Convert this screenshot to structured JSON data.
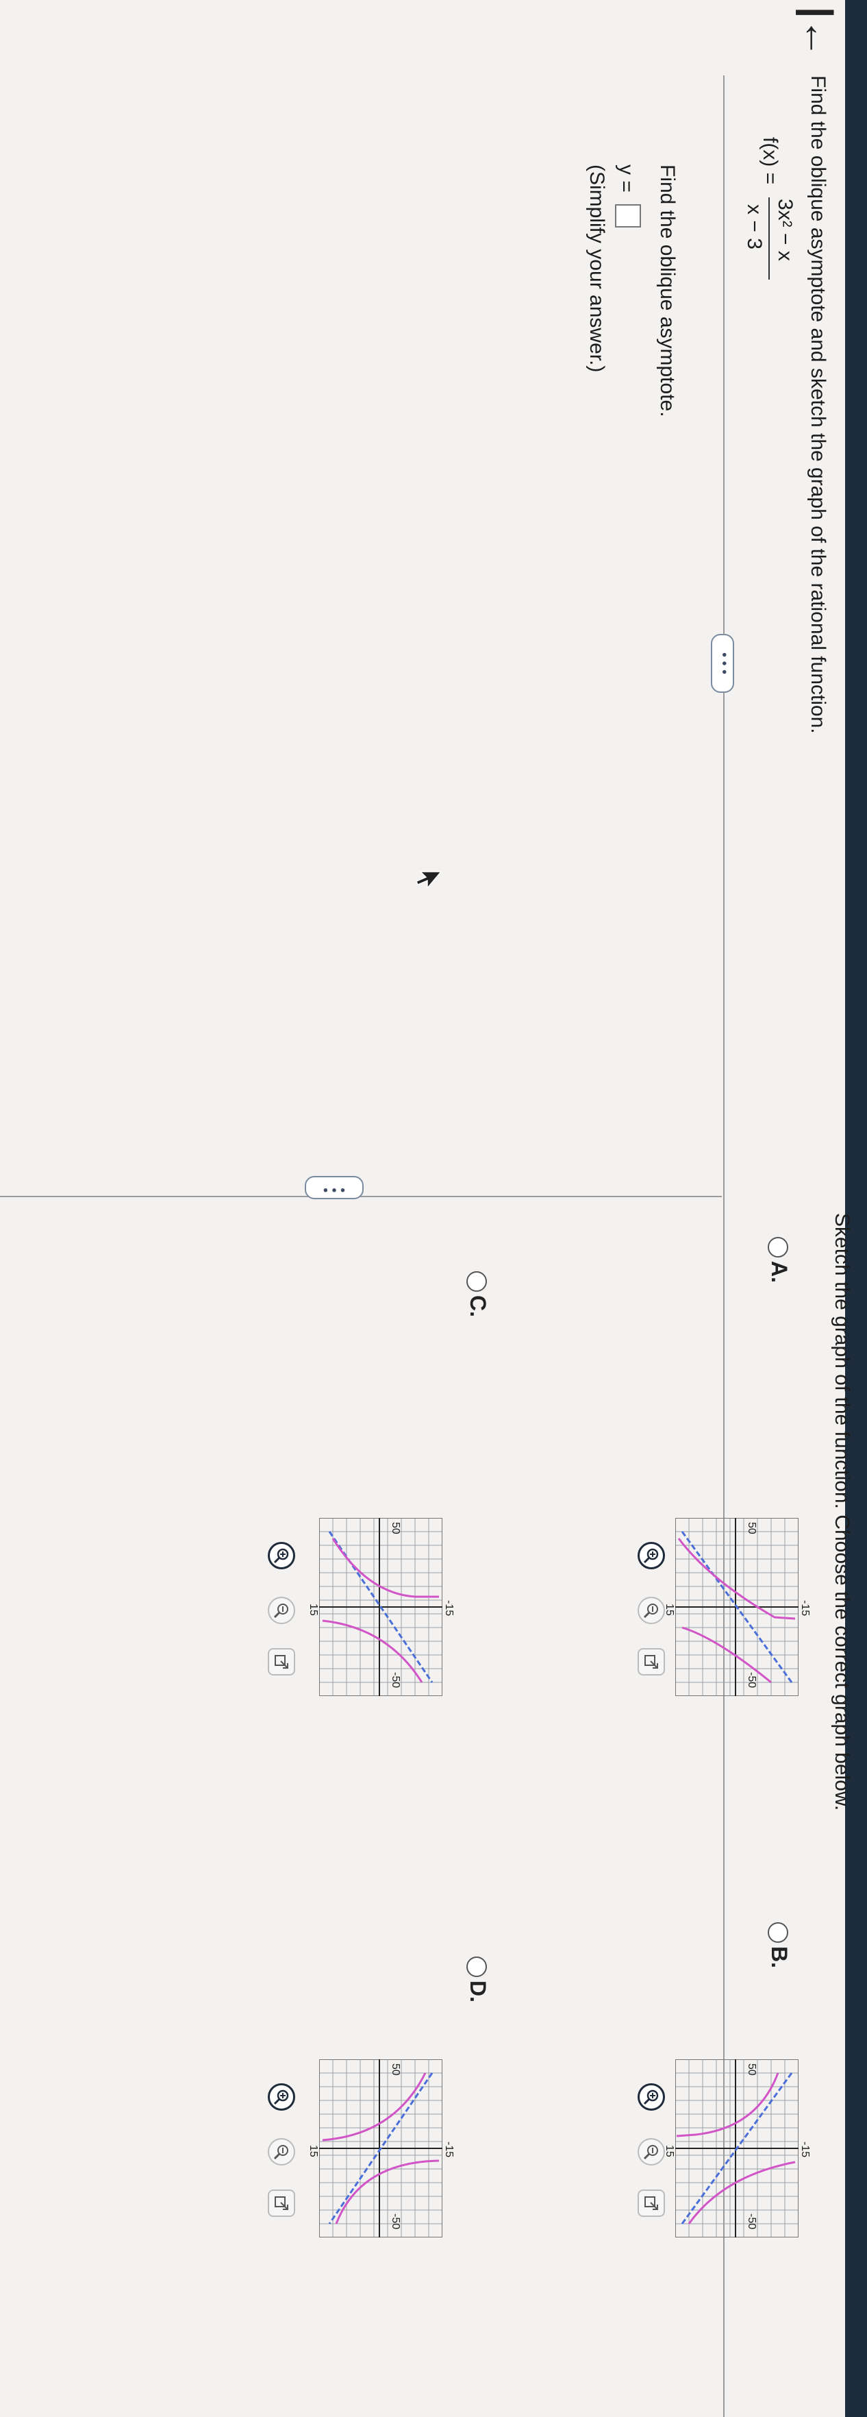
{
  "header": {
    "question": "Find the oblique asymptote and sketch the graph of the rational function.",
    "function_lhs": "f(x) =",
    "numerator": "3x",
    "numerator_exp": "2",
    "numerator_rest": " − x",
    "denominator": "x − 3"
  },
  "left_part": {
    "prompt": "Find the oblique asymptote.",
    "answer_prefix": "y =",
    "hint": "(Simplify your answer.)"
  },
  "more_button": "• • •",
  "right_part": {
    "prompt": "Sketch the graph of the function. Choose the correct graph below."
  },
  "options": [
    {
      "label": "A.",
      "y_top": "50",
      "y_bottom": "-50",
      "x_left": "-15",
      "x_right": "15",
      "x_axis": "x",
      "y_axis": "y"
    },
    {
      "label": "B.",
      "y_top": "50",
      "y_bottom": "-50",
      "x_left": "-15",
      "x_right": "15",
      "x_axis": "x",
      "y_axis": "y"
    },
    {
      "label": "C.",
      "y_top": "50",
      "y_bottom": "-50",
      "x_left": "-15",
      "x_right": "15",
      "x_axis": "x",
      "y_axis": "y"
    },
    {
      "label": "D.",
      "y_top": "50",
      "y_bottom": "-50",
      "x_left": "-15",
      "x_right": "15",
      "x_axis": "x",
      "y_axis": "y"
    }
  ],
  "colors": {
    "curve": "#d255c8",
    "asymptote": "#4a6fd9",
    "grid": "#9aa0a8",
    "topbar": "#1d2c3d"
  },
  "icons": {
    "back": "back-arrow-icon",
    "zoom_in": "zoom-in-icon",
    "zoom_out": "zoom-out-icon",
    "expand": "expand-icon"
  }
}
